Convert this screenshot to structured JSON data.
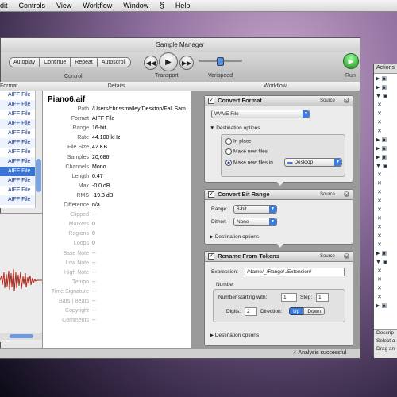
{
  "menubar": {
    "items": [
      "dit",
      "Controls",
      "View",
      "Workflow",
      "Window",
      "Help"
    ]
  },
  "window": {
    "title": "Sample Manager"
  },
  "toolbar": {
    "buttons": [
      "Autoplay",
      "Continue",
      "Repeat",
      "Autoscroll"
    ],
    "control_label": "Control",
    "transport_label": "Transport",
    "varispeed_label": "Varispeed",
    "run_label": "Run"
  },
  "columns": {
    "left": "Format",
    "details": "Details",
    "workflow": "Workflow"
  },
  "file_list": [
    "AIFF File",
    "AIFF File",
    "AIFF File",
    "AIFF File",
    "AIFF File",
    "AIFF File",
    "AIFF File",
    "AIFF File",
    "AIFF File",
    "AIFF File",
    "AIFF File",
    "AIFF File"
  ],
  "details": {
    "filename": "Piano6.aif",
    "rows": [
      {
        "label": "Path",
        "value": "/Users/chrissmalley/Desktop/Fall Sam..."
      },
      {
        "label": "Format",
        "value": "AIFF File"
      },
      {
        "label": "Range",
        "value": "16-bit"
      },
      {
        "label": "Rate",
        "value": "44.100 kHz"
      },
      {
        "label": "File Size",
        "value": "42 KB"
      },
      {
        "label": "Samples",
        "value": "20,686"
      },
      {
        "label": "Channels",
        "value": "Mono"
      },
      {
        "label": "Length",
        "value": "0.47"
      },
      {
        "label": "Max",
        "value": "-0.0 dB"
      },
      {
        "label": "RMS",
        "value": "-19.3 dB"
      },
      {
        "label": "Difference",
        "value": "n/a"
      },
      {
        "label": "Clipped",
        "value": "--"
      },
      {
        "label": "Markers",
        "value": "0"
      },
      {
        "label": "Regions",
        "value": "0"
      },
      {
        "label": "Loops",
        "value": "0"
      },
      {
        "label": "Base Note",
        "value": "--"
      },
      {
        "label": "Low Note",
        "value": "--"
      },
      {
        "label": "High Note",
        "value": "--"
      },
      {
        "label": "Tempo",
        "value": "--"
      },
      {
        "label": "Time Signature",
        "value": "--"
      },
      {
        "label": "Bars | Beats",
        "value": "--"
      },
      {
        "label": "Copyright",
        "value": "--"
      },
      {
        "label": "Comments",
        "value": "--"
      }
    ]
  },
  "workflow": {
    "convert": {
      "title": "Convert Format",
      "source": "Source",
      "format": "WAVE File",
      "dest_header": "Destination options",
      "radio_inplace": "In place",
      "radio_make": "Make new files",
      "radio_makein": "Make new files in",
      "folder": "Desktop"
    },
    "bitrange": {
      "title": "Convert Bit Range",
      "source": "Source",
      "range_label": "Range:",
      "range_value": "8-bit",
      "dither_label": "Dither:",
      "dither_value": "None",
      "dest_header": "Destination options"
    },
    "tokens": {
      "title": "Rename From Tokens",
      "source": "Source",
      "expr_label": "Expression:",
      "expr_value": "/Name/_/Range/./Extension/",
      "number_label": "Number",
      "start_label": "Number starting with:",
      "start_value": "1",
      "step_label": "Step:",
      "step_value": "1",
      "digits_label": "Digits:",
      "digits_value": "2",
      "direction_label": "Direction:",
      "up": "Up",
      "down": "Down",
      "dest_header": "Destination options"
    }
  },
  "status": {
    "text": "Analysis successful"
  },
  "actions": {
    "title": "Actions",
    "desc": "Descrip",
    "select": "Select a",
    "drag": "Drag an"
  }
}
